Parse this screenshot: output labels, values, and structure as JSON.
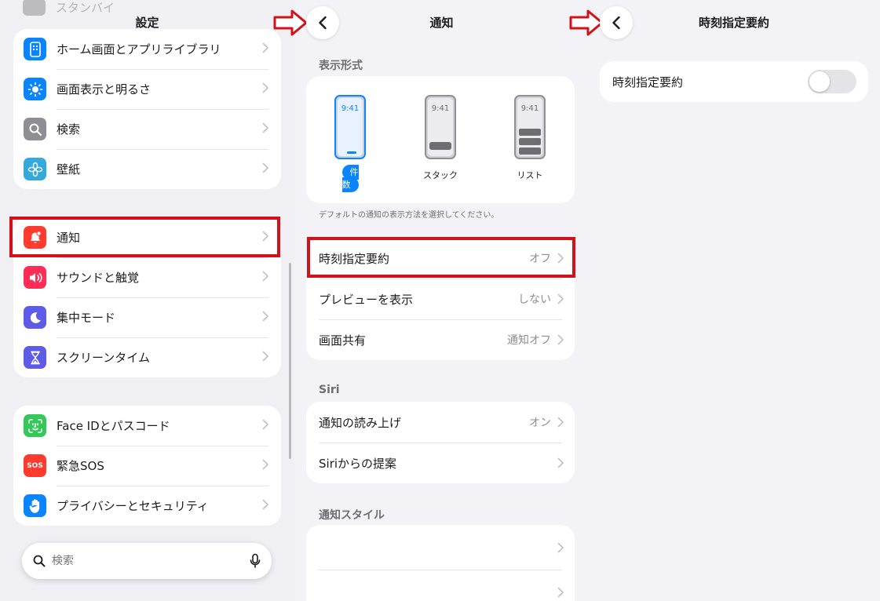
{
  "settings": {
    "title": "設定",
    "top_faded": "スタンバイ",
    "group1": [
      {
        "label": "ホーム画面とアプリライブラリ",
        "icon": "home-screen-icon",
        "color": "#0a84ff"
      },
      {
        "label": "画面表示と明るさ",
        "icon": "brightness-icon",
        "color": "#0a84ff"
      },
      {
        "label": "検索",
        "icon": "search-icon",
        "color": "#8e8e93"
      },
      {
        "label": "壁紙",
        "icon": "wallpaper-icon",
        "color": "#34aadc"
      }
    ],
    "group2": [
      {
        "label": "通知",
        "icon": "notifications-icon",
        "color": "#ff3b30"
      },
      {
        "label": "サウンドと触覚",
        "icon": "sound-icon",
        "color": "#ff2d55"
      },
      {
        "label": "集中モード",
        "icon": "moon-icon",
        "color": "#5e5ce6"
      },
      {
        "label": "スクリーンタイム",
        "icon": "hourglass-icon",
        "color": "#5e5ce6"
      }
    ],
    "group3": [
      {
        "label": "Face IDとパスコード",
        "icon": "face-id-icon",
        "color": "#34c759"
      },
      {
        "label": "緊急SOS",
        "icon": "sos-icon",
        "color": "#ff3b30",
        "badge": "SOS"
      },
      {
        "label": "プライバシーとセキュリティ",
        "icon": "hand-icon",
        "color": "#0a84ff"
      }
    ],
    "search_placeholder": "検索"
  },
  "notifications": {
    "title": "通知",
    "display_section": "表示形式",
    "styles": [
      {
        "label": "件数",
        "time": "9:41"
      },
      {
        "label": "スタック",
        "time": "9:41"
      },
      {
        "label": "リスト",
        "time": "9:41"
      }
    ],
    "display_footer": "デフォルトの通知の表示方法を選択してください。",
    "group1": [
      {
        "label": "時刻指定要約",
        "value": "オフ"
      },
      {
        "label": "プレビューを表示",
        "value": "しない"
      },
      {
        "label": "画面共有",
        "value": "通知オフ"
      }
    ],
    "siri_section": "Siri",
    "siri_rows": [
      {
        "label": "通知の読み上げ",
        "value": "オン"
      },
      {
        "label": "Siriからの提案",
        "value": ""
      }
    ],
    "style_section": "通知スタイル"
  },
  "summary": {
    "title": "時刻指定要約",
    "toggle_label": "時刻指定要約",
    "toggle_on": false
  },
  "colors": {
    "accent": "#0a84ff",
    "highlight": "#d0121b"
  }
}
